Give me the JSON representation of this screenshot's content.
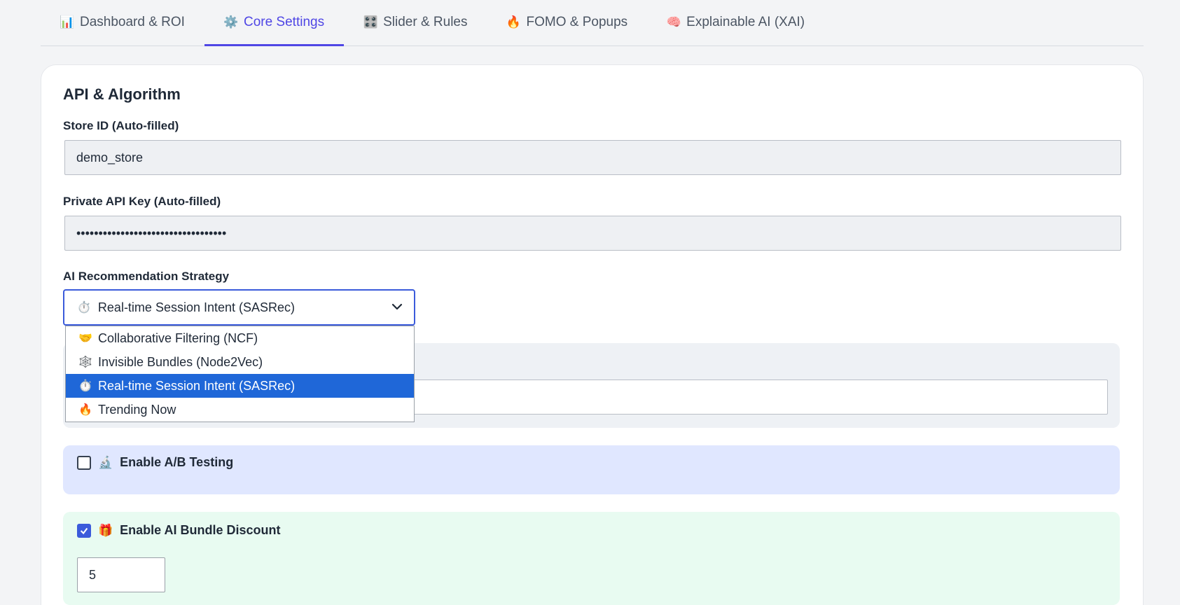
{
  "tabs": [
    {
      "icon": "📊",
      "label": "Dashboard & ROI",
      "active": false
    },
    {
      "icon": "⚙️",
      "label": "Core Settings",
      "active": true
    },
    {
      "icon": "🎛️",
      "label": "Slider & Rules",
      "active": false
    },
    {
      "icon": "🔥",
      "label": "FOMO & Popups",
      "active": false
    },
    {
      "icon": "🧠",
      "label": "Explainable AI (XAI)",
      "active": false
    }
  ],
  "section": {
    "title": "API & Algorithm"
  },
  "store_id": {
    "label": "Store ID (Auto-filled)",
    "value": "demo_store"
  },
  "api_key": {
    "label": "Private API Key (Auto-filled)",
    "value": "••••••••••••••••••••••••••••••••••"
  },
  "strategy": {
    "label": "AI Recommendation Strategy",
    "selected_icon": "⏱️",
    "selected": "Real-time Session Intent (SASRec)",
    "options": [
      {
        "icon": "🤝",
        "label": "Collaborative Filtering (NCF)"
      },
      {
        "icon": "🕸️",
        "label": "Invisible Bundles (Node2Vec)"
      },
      {
        "icon": "⏱️",
        "label": "Real-time Session Intent (SASRec)"
      },
      {
        "icon": "🔥",
        "label": "Trending Now"
      }
    ]
  },
  "ab_testing": {
    "icon": "🔬",
    "label": "Enable A/B Testing",
    "checked": false
  },
  "bundle_discount": {
    "icon": "🎁",
    "label": "Enable AI Bundle Discount",
    "checked": true,
    "value": "5"
  },
  "colors": {
    "accent": "#4f46e5",
    "select_highlight": "#1f67d8",
    "ab_panel": "#e0e7ff",
    "discount_panel": "#e8fbf1"
  }
}
